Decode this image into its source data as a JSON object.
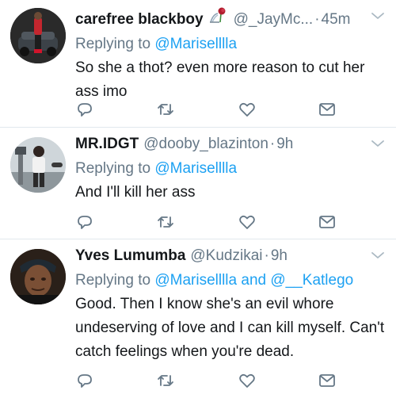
{
  "tweets": [
    {
      "name": "carefree blackboy",
      "handle": "@_JayMc...",
      "time": "45m",
      "replying_prefix": "Replying to ",
      "mentions": [
        "@Mariselllla"
      ],
      "mentions_joiner": "",
      "text": "So she a thot? even more reason to cut her ass imo",
      "has_emoji": true,
      "emoji": "rose-on-fountain-icon"
    },
    {
      "name": "MR.IDGT",
      "handle": "@dooby_blazinton",
      "time": "9h",
      "replying_prefix": "Replying to ",
      "mentions": [
        "@Mariselllla"
      ],
      "mentions_joiner": "",
      "text": "And I'll kill her ass"
    },
    {
      "name": "Yves Lumumba",
      "handle": "@Kudzikai",
      "time": "9h",
      "replying_prefix": "Replying to ",
      "mentions": [
        "@Mariselllla",
        "@__Katlego"
      ],
      "mentions_joiner": " and ",
      "text": "Good. Then I know she's an evil whore undeserving of love and I can kill myself. Can't catch feelings when you're dead."
    }
  ],
  "action_icons": [
    "reply-icon",
    "retweet-icon",
    "like-icon",
    "direct-message-icon"
  ],
  "colors": {
    "text": "#14171a",
    "secondary": "#657786",
    "link": "#1da1f2",
    "divider": "#e1e8ed"
  }
}
